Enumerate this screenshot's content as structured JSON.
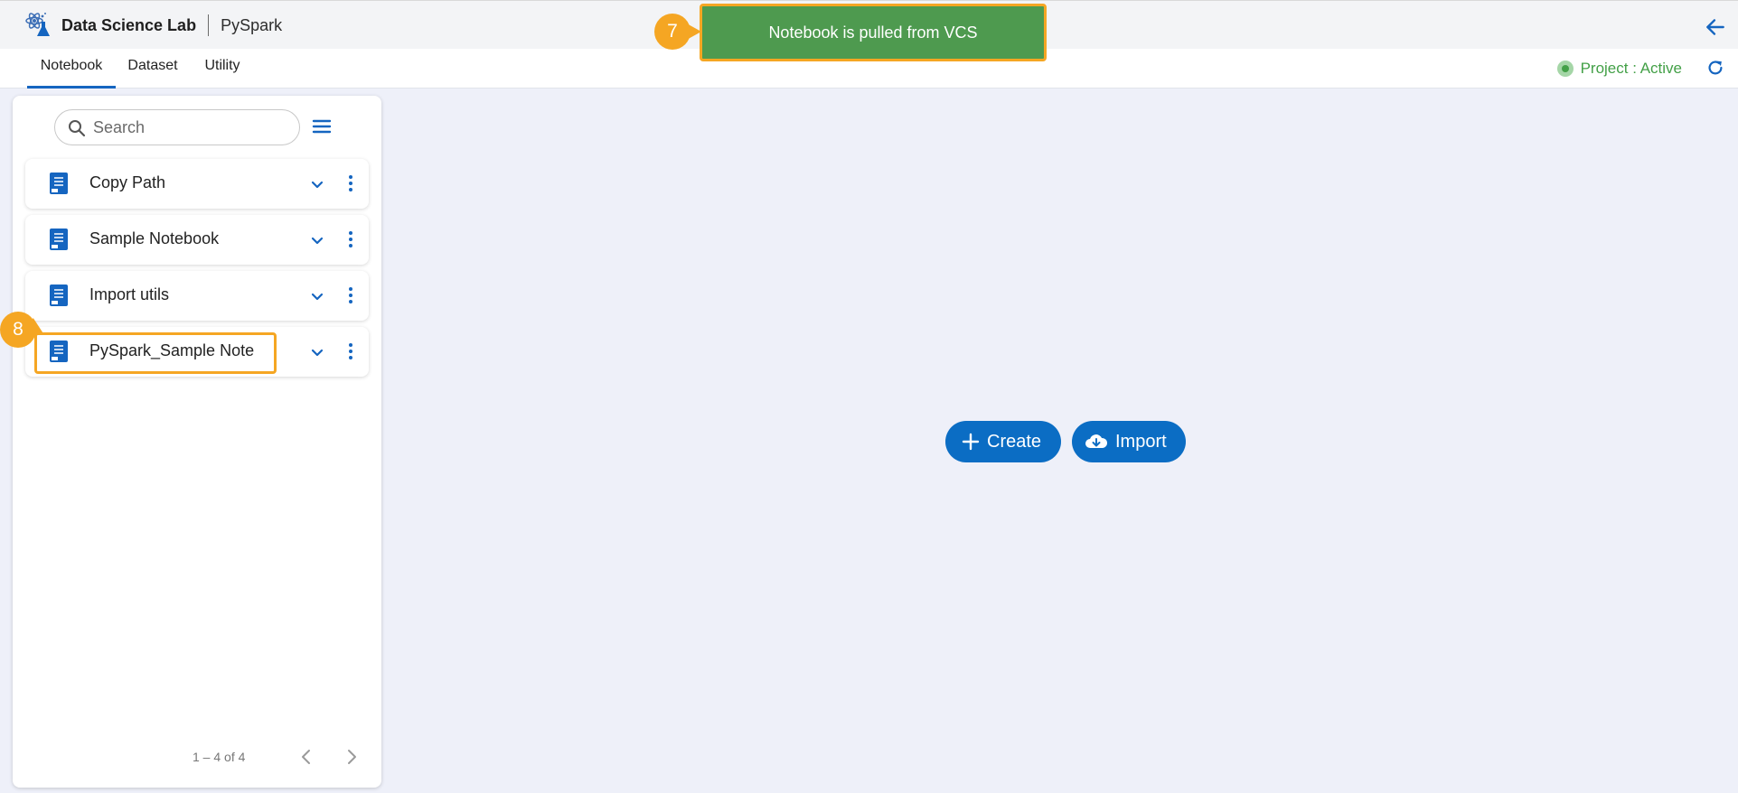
{
  "app": {
    "title": "Data Science Lab",
    "subtitle": "PySpark",
    "icon": "flask-atom-icon"
  },
  "tabs": [
    {
      "label": "Notebook",
      "active": true
    },
    {
      "label": "Dataset",
      "active": false
    },
    {
      "label": "Utility",
      "active": false
    }
  ],
  "status": {
    "text": "Project : Active",
    "color": "#43a047"
  },
  "sidebar": {
    "search_placeholder": "Search",
    "items": [
      {
        "label": "Copy Path"
      },
      {
        "label": "Sample Notebook"
      },
      {
        "label": "Import utils"
      },
      {
        "label": "PySpark_Sample Note"
      }
    ],
    "pagination": "1 – 4 of 4"
  },
  "actions": {
    "create_label": "Create",
    "import_label": "Import"
  },
  "toast": {
    "text": "Notebook is pulled from VCS",
    "color": "#4e9a4f"
  },
  "annotations": {
    "step_7": "7",
    "step_8": "8",
    "highlight_color": "#f5a623"
  },
  "colors": {
    "accent": "#0b6dc4",
    "background": "#eef0f9"
  }
}
